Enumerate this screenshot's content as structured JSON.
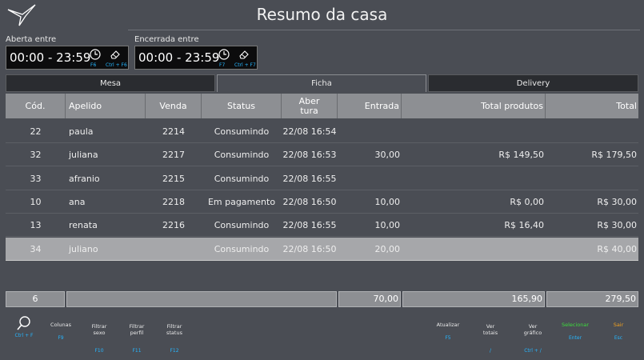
{
  "page_title": "Resumo da casa",
  "filters": {
    "opened": {
      "label": "Aberta entre",
      "value": "00:00 - 23:59",
      "key_time": "F6",
      "key_clear": "Ctrl + F6"
    },
    "closed": {
      "label": "Encerrada entre",
      "value": "00:00 - 23:59",
      "key_time": "F7",
      "key_clear": "Ctrl + F7"
    }
  },
  "tabs": [
    "Mesa",
    "Ficha",
    "Delivery"
  ],
  "columns": [
    "Cód.",
    "Apelido",
    "Venda",
    "Status",
    "Aber\ntura",
    "Entrada",
    "Total produtos",
    "Total"
  ],
  "rows": [
    [
      "22",
      "paula",
      "2214",
      "Consumindo",
      "22/08 16:54",
      "",
      "",
      ""
    ],
    [
      "32",
      "juliana",
      "2217",
      "Consumindo",
      "22/08 16:53",
      "30,00",
      "R$ 149,50",
      "R$ 179,50"
    ],
    [
      "33",
      "afranio",
      "2215",
      "Consumindo",
      "22/08 16:55",
      "",
      "",
      ""
    ],
    [
      "10",
      "ana",
      "2218",
      "Em pagamento",
      "22/08 16:50",
      "10,00",
      "R$ 0,00",
      "R$ 30,00"
    ],
    [
      "13",
      "renata",
      "2216",
      "Consumindo",
      "22/08 16:55",
      "10,00",
      "R$ 16,40",
      "R$ 30,00"
    ],
    [
      "34",
      "juliano",
      "",
      "Consumindo",
      "22/08 16:50",
      "20,00",
      "",
      "R$ 40,00"
    ]
  ],
  "totals": {
    "count": "6",
    "entrada": "70,00",
    "produtos": "165,90",
    "total": "279,50"
  },
  "toolbar": [
    {
      "label": "",
      "key": "Ctrl + F",
      "icon": "search-icon"
    },
    {
      "label": "Colunas",
      "key": "F9"
    },
    {
      "label": "Filtrar\nsexo",
      "key": "F10"
    },
    {
      "label": "Filtrar\nperfil",
      "key": "F11"
    },
    {
      "label": "Filtrar\nstatus",
      "key": "F12"
    },
    {
      "label": "Atualizar",
      "key": "F5"
    },
    {
      "label": "Ver\ntotais",
      "key": "/"
    },
    {
      "label": "Ver\ngráfico",
      "key": "Ctrl + /"
    },
    {
      "label": "Selecionar",
      "key": "Enter",
      "color": "#3ddc3d"
    },
    {
      "label": "Sair",
      "key": "Esc",
      "color": "#f0a020"
    }
  ]
}
